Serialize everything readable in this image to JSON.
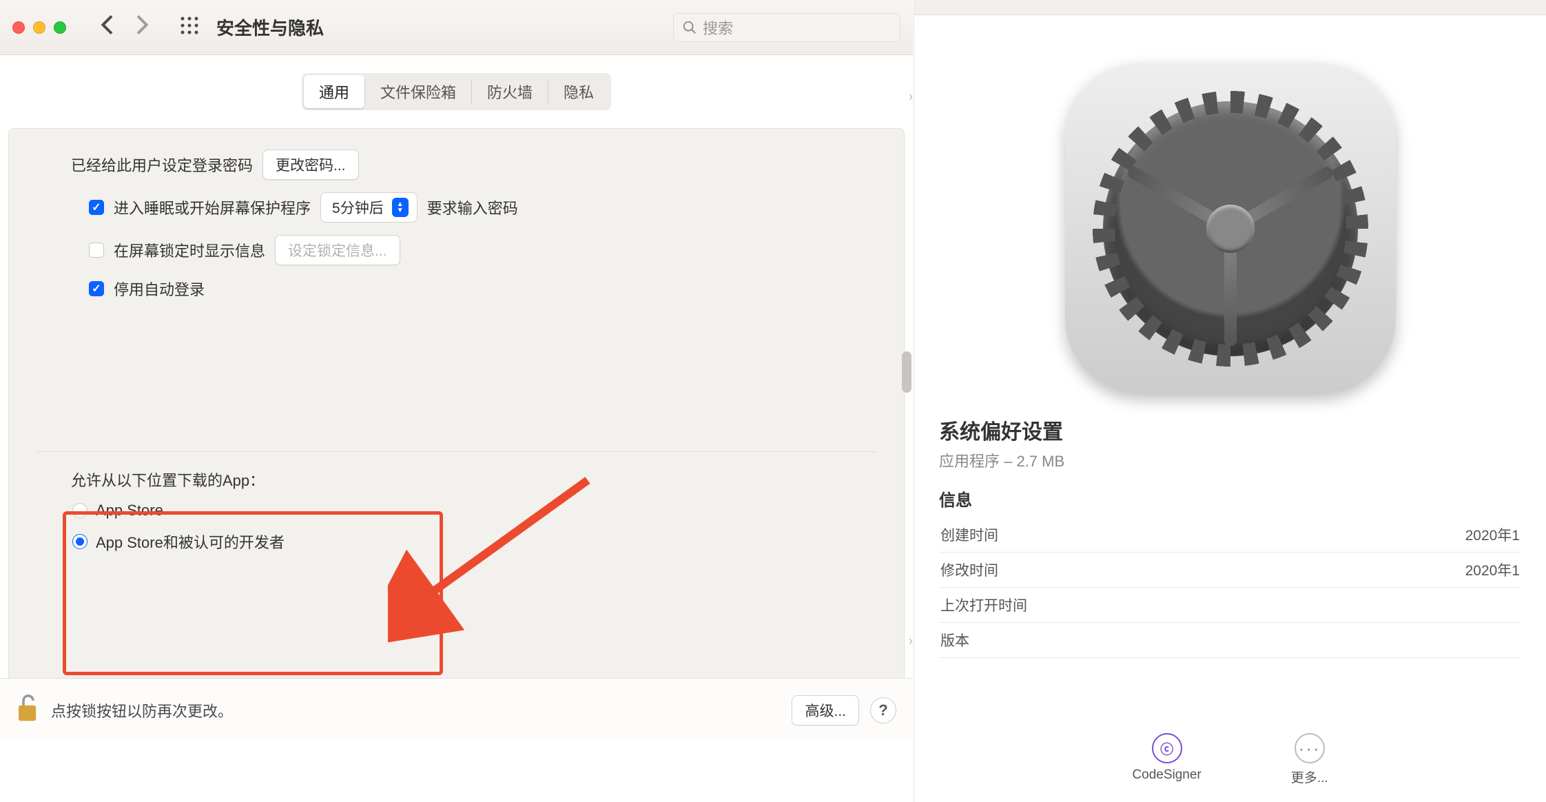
{
  "prefs": {
    "title": "安全性与隐私",
    "search_placeholder": "搜索",
    "tabs": {
      "general": "通用",
      "filevault": "文件保险箱",
      "firewall": "防火墙",
      "privacy": "隐私"
    },
    "login_password_set": "已经给此用户设定登录密码",
    "change_password": "更改密码...",
    "require_password_prefix": "进入睡眠或开始屏幕保护程序",
    "require_password_delay": "5分钟后",
    "require_password_suffix": "要求输入密码",
    "show_message": "在屏幕锁定时显示信息",
    "set_lock_message": "设定锁定信息...",
    "disable_autologin": "停用自动登录",
    "allow_apps_from": "允许从以下位置下载的App：",
    "radio_app_store": "App Store",
    "radio_identified": "App Store和被认可的开发者",
    "lock_text": "点按锁按钮以防再次更改。",
    "advanced": "高级...",
    "help": "?"
  },
  "finder": {
    "app_name": "系统偏好设置",
    "kind_size": "应用程序 – 2.7 MB",
    "info_header": "信息",
    "rows": {
      "created_label": "创建时间",
      "created_value": "2020年1",
      "modified_label": "修改时间",
      "modified_value": "2020年1",
      "opened_label": "上次打开时间",
      "opened_value": "",
      "version_label": "版本",
      "version_value": ""
    },
    "action_codesigner": "CodeSigner",
    "action_more": "更多..."
  }
}
